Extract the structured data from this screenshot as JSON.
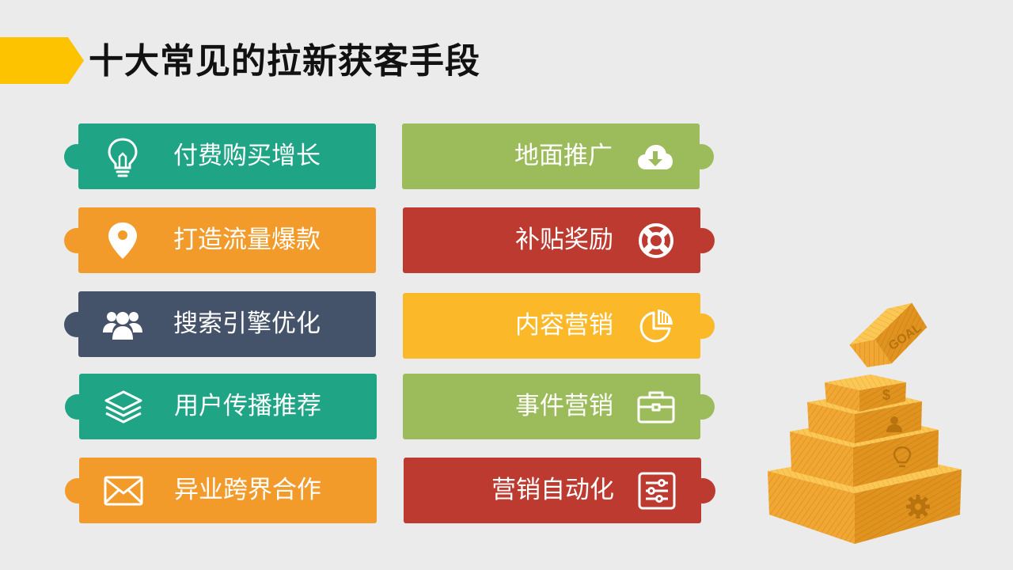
{
  "header": {
    "title": "十大常见的拉新获客手段",
    "accent_color": "#fdc300"
  },
  "left_column": [
    {
      "label": "付费购买增长",
      "icon": "lightbulb-icon",
      "color": "#1fa486"
    },
    {
      "label": "打造流量爆款",
      "icon": "location-pin-icon",
      "color": "#f29b2a"
    },
    {
      "label": "搜索引擎优化",
      "icon": "users-group-icon",
      "color": "#44536a"
    },
    {
      "label": "用户传播推荐",
      "icon": "layers-icon",
      "color": "#1fa486"
    },
    {
      "label": "异业跨界合作",
      "icon": "envelope-icon",
      "color": "#f29b2a"
    }
  ],
  "right_column": [
    {
      "label": "地面推广",
      "icon": "cloud-download-icon",
      "color": "#9cbc5b"
    },
    {
      "label": "补贴奖励",
      "icon": "lifebuoy-icon",
      "color": "#bd3a30"
    },
    {
      "label": "内容营销",
      "icon": "pie-chart-icon",
      "color": "#fbb829"
    },
    {
      "label": "事件营销",
      "icon": "briefcase-icon",
      "color": "#9cbc5b"
    },
    {
      "label": "营销自动化",
      "icon": "sliders-icon",
      "color": "#bd3a30"
    }
  ],
  "illustration": {
    "goal_text": "GOAL",
    "dollar_text": "$",
    "icon": "goal-pyramid-icon"
  }
}
